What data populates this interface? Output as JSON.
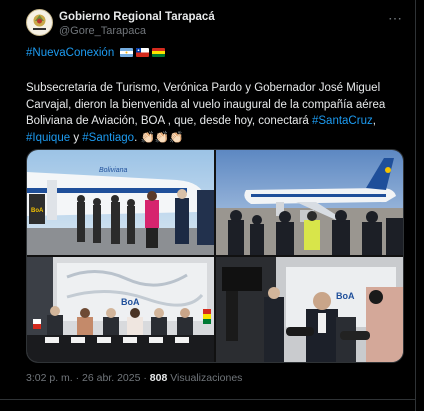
{
  "account": {
    "name": "Gobierno Regional Tarapacá",
    "handle": "@Gore_Tarapaca",
    "avatar_icon": "regional-seal-icon"
  },
  "menu_icon": "more-options-icon",
  "post": {
    "hashtag_top": "#NuevaConexión",
    "flags": [
      "argentina-flag-icon",
      "chile-flag-icon",
      "bolivia-flag-icon"
    ],
    "text_1": "Subsecretaria de Turismo, Verónica Pardo y Gobernador José Miguel Carvajal, dieron la bienvenida al vuelo inaugural de la compañía aérea Boliviana de Aviación, BOA , que, desde hoy, conectará ",
    "tag_santacruz": "#SantaCruz",
    "sep_1": ",",
    "tag_iquique": "#Iquique",
    "sep_2": " y ",
    "tag_santiago": "#Santiago",
    "sep_3": ".",
    "claps": "👏🏻👏🏻👏🏻"
  },
  "media": {
    "photo1_logo": "BoA",
    "photo1_plane_text": "Boliviana",
    "photo3_logo": "BoA",
    "photo4_logo": "BoA"
  },
  "footer": {
    "time": "3:02 p. m.",
    "sep": " · ",
    "date": "26 abr. 2025",
    "views_count": "808",
    "views_label": "Visualizaciones"
  },
  "colors": {
    "background": "#000000",
    "link": "#1d9bf0",
    "muted": "#71767b"
  }
}
